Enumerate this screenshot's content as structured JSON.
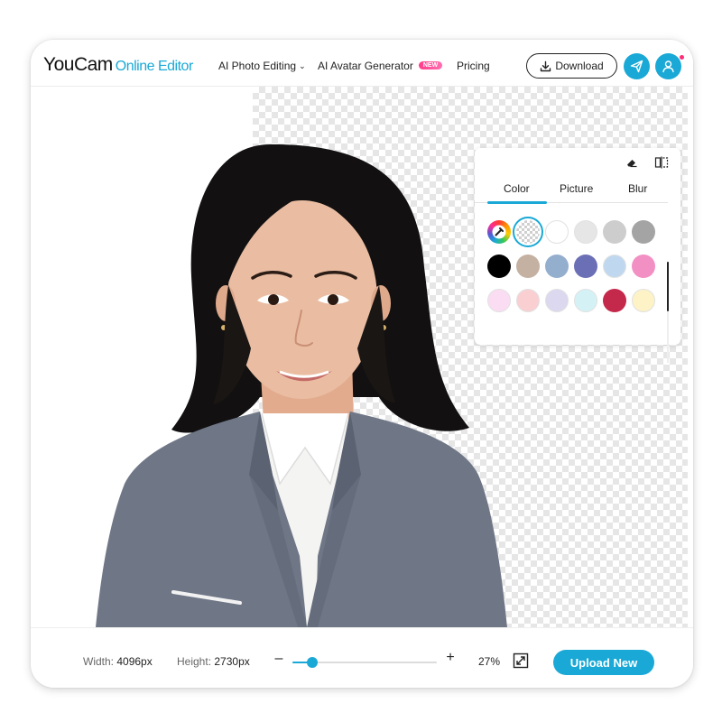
{
  "app": {
    "brand": "YouCam",
    "product": "Online Editor"
  },
  "nav": {
    "items": [
      {
        "label": "AI Photo Editing",
        "has_dropdown": true
      },
      {
        "label": "AI Avatar Generator",
        "badge": "NEW"
      },
      {
        "label": "Pricing"
      }
    ]
  },
  "header_actions": {
    "download_label": "Download",
    "download_icon": "download-icon",
    "send_icon": "paper-plane-icon",
    "account_icon": "user-icon",
    "notification_dot": true
  },
  "panel": {
    "tools": [
      "eraser-icon",
      "compare-icon"
    ],
    "tabs": [
      {
        "label": "Color",
        "active": true
      },
      {
        "label": "Picture",
        "active": false
      },
      {
        "label": "Blur",
        "active": false
      }
    ],
    "swatches": [
      {
        "type": "picker",
        "icon": "eyedropper-color-wheel-icon"
      },
      {
        "type": "transparent",
        "selected": true
      },
      {
        "type": "color",
        "color": "#ffffff"
      },
      {
        "type": "color",
        "color": "#e6e6e6"
      },
      {
        "type": "color",
        "color": "#cdcdcd"
      },
      {
        "type": "color",
        "color": "#a4a4a4"
      },
      {
        "type": "color",
        "color": "#000000"
      },
      {
        "type": "color",
        "color": "#c4b1a2"
      },
      {
        "type": "color",
        "color": "#94aece"
      },
      {
        "type": "color",
        "color": "#6b6fb5"
      },
      {
        "type": "color",
        "color": "#c0d8ef"
      },
      {
        "type": "color",
        "color": "#f28fc3"
      },
      {
        "type": "color",
        "color": "#fbddf3"
      },
      {
        "type": "color",
        "color": "#f9cfd2"
      },
      {
        "type": "color",
        "color": "#dbd8ef"
      },
      {
        "type": "color",
        "color": "#d4f2f5"
      },
      {
        "type": "color",
        "color": "#c4284b"
      },
      {
        "type": "color",
        "color": "#fdf3c6"
      }
    ]
  },
  "footer": {
    "width_label": "Width:",
    "width_value": "4096px",
    "height_label": "Height:",
    "height_value": "2730px",
    "zoom_out": "–",
    "zoom_in": "+",
    "zoom_value": "27%",
    "zoom_fraction": 0.14,
    "fit_icon": "expand-icon",
    "upload_label": "Upload New"
  },
  "colors": {
    "accent": "#1aa9d6",
    "badge": "#ff4d94",
    "text": "#222222"
  }
}
